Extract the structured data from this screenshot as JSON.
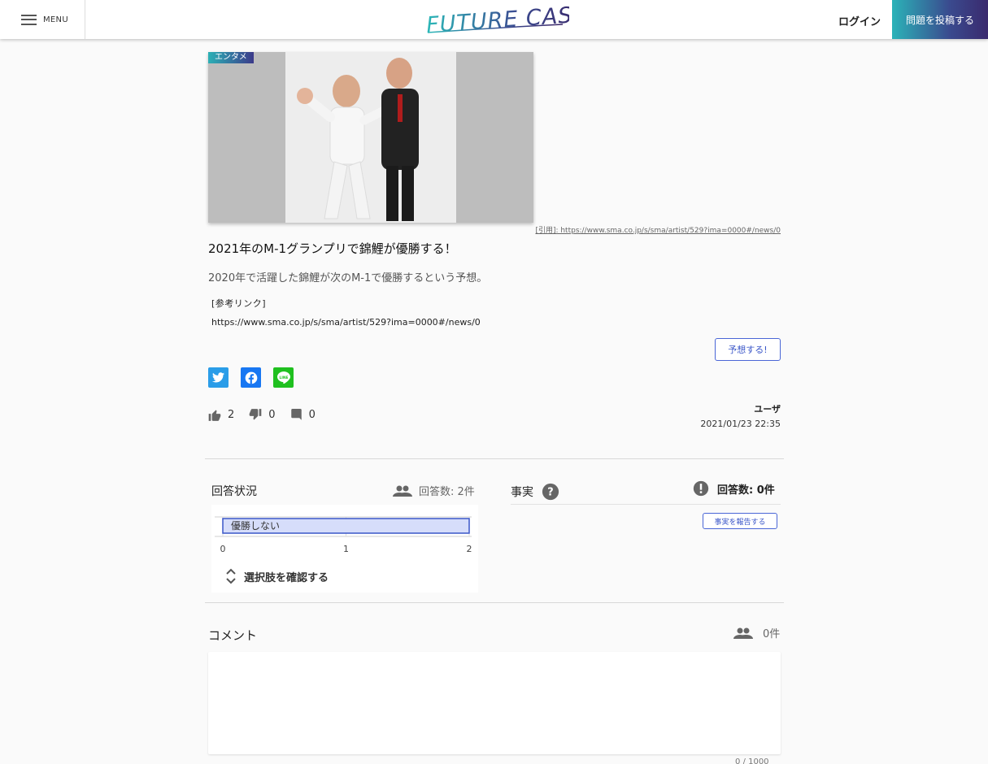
{
  "header": {
    "menu_label": "MENU",
    "logo_text": "FUTURE CAST",
    "login_label": "ログイン",
    "post_button_label": "問題を投稿する"
  },
  "question": {
    "category": "エンタメ",
    "citation": "[引用]: https://www.sma.co.jp/s/sma/artist/529?ima=0000#/news/0",
    "title": "2021年のM-1グランプリで錦鯉が優勝する！",
    "description": "2020年で活躍した錦鯉が次のM-1で優勝するという予想。",
    "reference_label": "[参考リンク]",
    "reference_url": "https://www.sma.co.jp/s/sma/artist/529?ima=0000#/news/0",
    "predict_button_label": "予想する!",
    "likes": "2",
    "dislikes": "0",
    "comments": "0",
    "author": "ユーザ",
    "date": "2021/01/23 22:35"
  },
  "share": {
    "icons": [
      "twitter-icon",
      "facebook-icon",
      "line-icon"
    ]
  },
  "answer_status": {
    "title": "回答状況",
    "count_label": "回答数: 2件",
    "expand_label": "選択肢を確認する"
  },
  "chart_data": {
    "type": "bar",
    "orientation": "horizontal",
    "categories": [
      "優勝しない"
    ],
    "values": [
      2
    ],
    "xlim": [
      0,
      2
    ],
    "xticks": [
      "0",
      "1",
      "2"
    ],
    "bar_color": "#d6ddfa",
    "bar_border": "#3a56c8"
  },
  "facts": {
    "title": "事実",
    "count_label": "回答数: 0件",
    "report_button_label": "事実を報告する"
  },
  "comments_section": {
    "title": "コメント",
    "count_label": "0件",
    "char_count": "0 / 1000"
  }
}
